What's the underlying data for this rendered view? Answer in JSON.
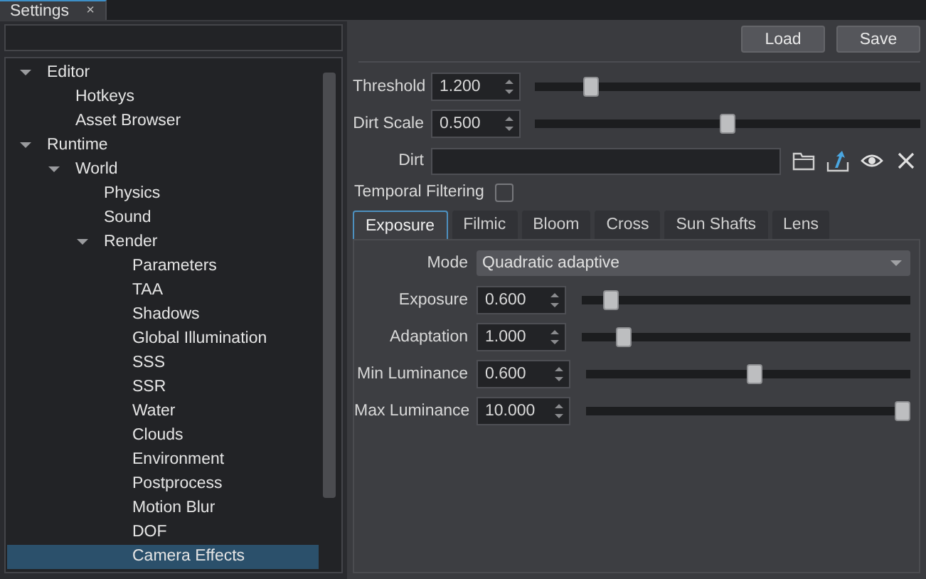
{
  "window": {
    "tab": {
      "title": "Settings",
      "close": "×"
    }
  },
  "sidebar": {
    "tree": [
      {
        "label": "Editor",
        "expanded": true,
        "selected": false,
        "children": [
          {
            "label": "Hotkeys",
            "selected": false
          },
          {
            "label": "Asset Browser",
            "selected": false
          }
        ]
      },
      {
        "label": "Runtime",
        "expanded": true,
        "selected": false,
        "children": [
          {
            "label": "World",
            "expanded": true,
            "selected": false,
            "children": [
              {
                "label": "Physics",
                "selected": false
              },
              {
                "label": "Sound",
                "selected": false
              },
              {
                "label": "Render",
                "expanded": true,
                "selected": false,
                "children": [
                  {
                    "label": "Parameters",
                    "selected": false
                  },
                  {
                    "label": "TAA",
                    "selected": false
                  },
                  {
                    "label": "Shadows",
                    "selected": false
                  },
                  {
                    "label": "Global Illumination",
                    "selected": false
                  },
                  {
                    "label": "SSS",
                    "selected": false
                  },
                  {
                    "label": "SSR",
                    "selected": false
                  },
                  {
                    "label": "Water",
                    "selected": false
                  },
                  {
                    "label": "Clouds",
                    "selected": false
                  },
                  {
                    "label": "Environment",
                    "selected": false
                  },
                  {
                    "label": "Postprocess",
                    "selected": false
                  },
                  {
                    "label": "Motion Blur",
                    "selected": false
                  },
                  {
                    "label": "DOF",
                    "selected": false
                  },
                  {
                    "label": "Camera Effects",
                    "selected": true
                  }
                ]
              }
            ]
          }
        ]
      }
    ]
  },
  "toolbar": {
    "buttons": [
      "Load",
      "Save"
    ]
  },
  "params": [
    {
      "kind": "slider",
      "label": "Threshold",
      "value": "1.200",
      "level": 0.13
    },
    {
      "kind": "slider",
      "label": "Dirt Scale",
      "value": "0.500",
      "level": 0.5
    },
    {
      "kind": "file",
      "label": "Dirt"
    },
    {
      "kind": "checkbox",
      "label": "Temporal Filtering",
      "checked": false
    }
  ],
  "tabs": [
    {
      "label": "Exposure",
      "selected": true
    },
    {
      "label": "Filmic",
      "selected": false
    },
    {
      "label": "Bloom",
      "selected": false
    },
    {
      "label": "Cross",
      "selected": false
    },
    {
      "label": "Sun Shafts",
      "selected": false
    },
    {
      "label": "Lens",
      "selected": false
    }
  ],
  "exposure": [
    {
      "kind": "combo",
      "label": "Mode",
      "value": "Quadratic adaptive"
    },
    {
      "kind": "slider",
      "label": "Exposure",
      "value": "0.600",
      "level": 0.07
    },
    {
      "kind": "slider",
      "label": "Adaptation",
      "value": "1.000",
      "level": 0.11
    },
    {
      "kind": "slider",
      "label": "Min Luminance",
      "value": "0.600",
      "level": 0.52
    },
    {
      "kind": "slider",
      "label": "Max Luminance",
      "value": "10.000",
      "level": 1
    }
  ]
}
